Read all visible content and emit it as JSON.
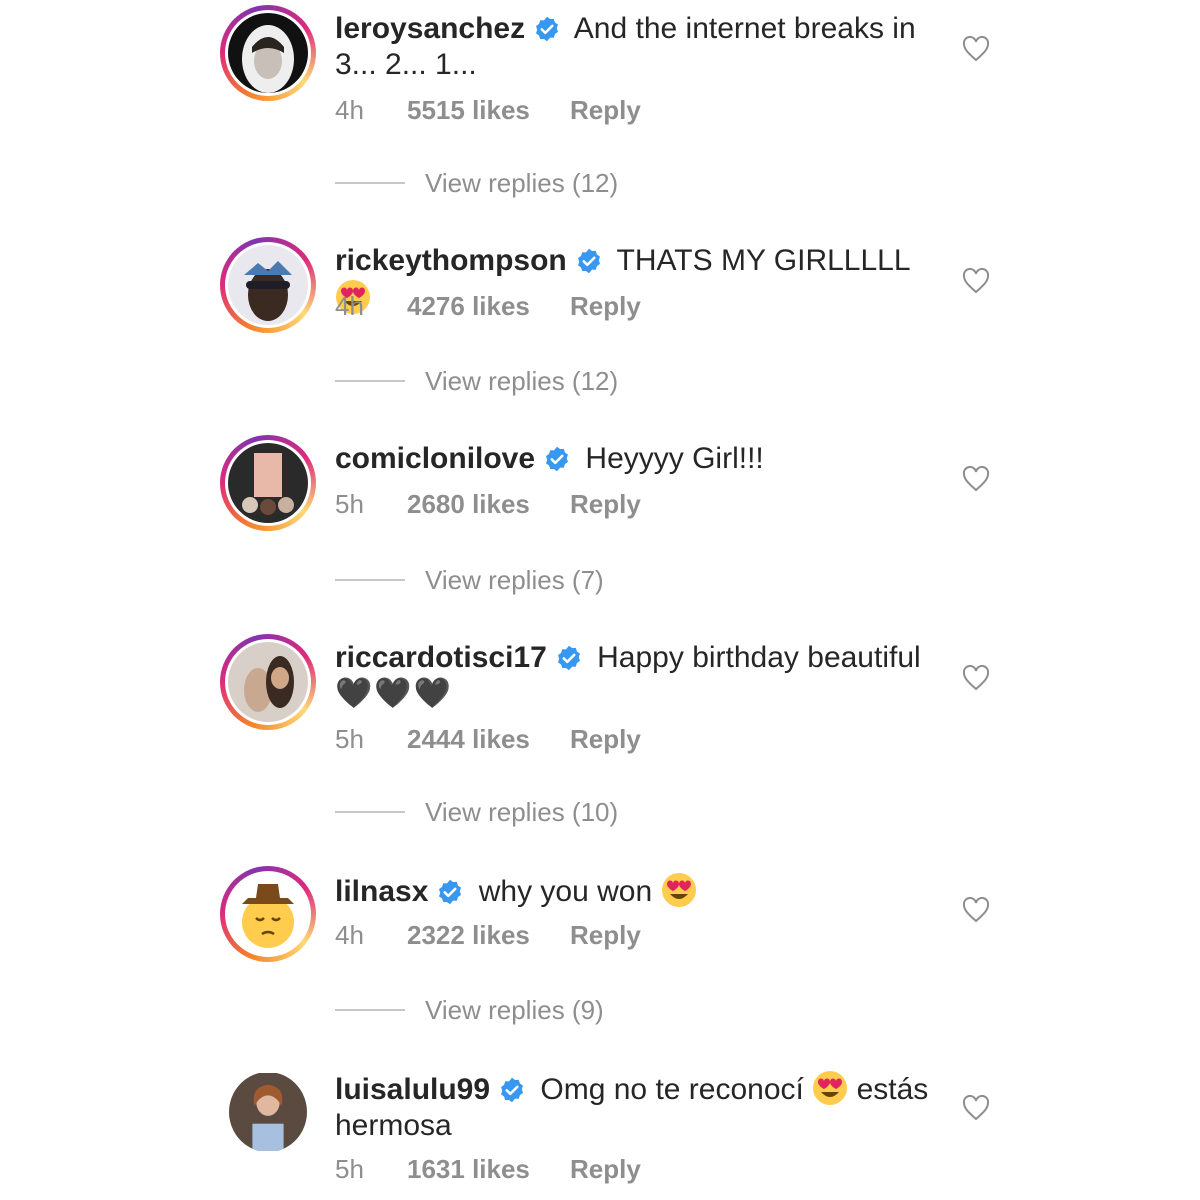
{
  "comments": [
    {
      "username": "leroysanchez",
      "text": "And the internet breaks in 3... 2... 1...",
      "time": "4h",
      "likes": "5515 likes",
      "reply": "Reply",
      "view_replies": "View replies (12)",
      "verified_icon": "verified-badge-icon",
      "emoji": null
    },
    {
      "username": "rickeythompson",
      "text": "THATS MY GIRLLLLL",
      "time": "4h",
      "likes": "4276 likes",
      "reply": "Reply",
      "view_replies": "View replies (12)",
      "emoji": "heart-eyes-emoji"
    },
    {
      "username": "comiclonilove",
      "text": "Heyyyy Girl!!!",
      "time": "5h",
      "likes": "2680 likes",
      "reply": "Reply",
      "view_replies": "View replies (7)"
    },
    {
      "username": "riccardotisci17",
      "text": "Happy birthday beautiful",
      "text2": "🖤🖤🖤",
      "time": "5h",
      "likes": "2444 likes",
      "reply": "Reply",
      "view_replies": "View replies (10)"
    },
    {
      "username": "lilnasx",
      "text": "why you won",
      "time": "4h",
      "likes": "2322 likes",
      "reply": "Reply",
      "view_replies": "View replies (9)",
      "emoji": "heart-eyes-emoji"
    },
    {
      "username": "luisalulu99",
      "text": "Omg no te reconocí",
      "text_after_emoji": "estás hermosa",
      "time": "5h",
      "likes": "1631 likes",
      "reply": "Reply",
      "emoji": "heart-eyes-emoji"
    }
  ],
  "colors": {
    "verified": "#3897f0",
    "secondary_text": "#8e8e8e",
    "primary_text": "#262626",
    "story_ring": [
      "#f58529",
      "#dd2a7b",
      "#8134af"
    ]
  }
}
